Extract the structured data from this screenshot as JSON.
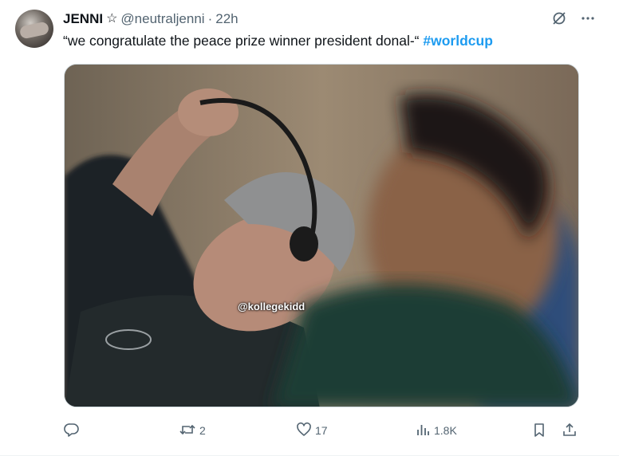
{
  "tweet": {
    "author": {
      "name": "JENNI",
      "badge": "☆",
      "handle": "@neutraljenni",
      "separator": "·",
      "time": "22h"
    },
    "text": "“we congratulate the peace prize winner president donal-“ ",
    "hashtag": "#worldcup",
    "media": {
      "watermark": "@kollegekidd"
    },
    "top_actions": [
      "grok-icon",
      "more-icon"
    ],
    "actions": {
      "reply": {
        "icon": "reply-icon",
        "count": ""
      },
      "retweet": {
        "icon": "retweet-icon",
        "count": "2"
      },
      "like": {
        "icon": "heart-icon",
        "count": "17"
      },
      "views": {
        "icon": "views-icon",
        "count": "1.8K"
      },
      "bookmark": {
        "icon": "bookmark-icon"
      },
      "share": {
        "icon": "share-icon"
      }
    }
  },
  "colors": {
    "text": "#0f1419",
    "secondary": "#536471",
    "link": "#1d9bf0"
  }
}
